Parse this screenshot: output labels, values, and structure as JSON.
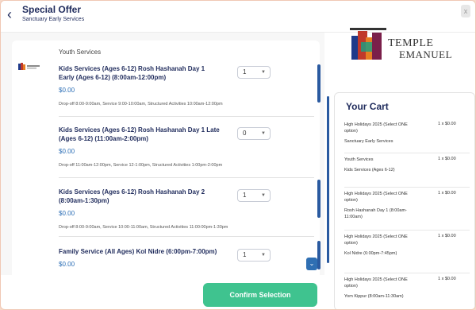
{
  "header": {
    "title": "Special Offer",
    "subtitle": "Sanctuary Early Services",
    "close_label": "x"
  },
  "list": {
    "group_label": "Youth Services",
    "items": [
      {
        "title": "Kids Services (Ages 6-12) Rosh Hashanah Day 1 Early (Ages 6-12) (8:00am-12:00pm)",
        "price": "$0.00",
        "description": "Drop-off 8:00-9:00am, Service 9:00-10:00am, Structured Activities 10:00am-12:00pm",
        "qty": "1"
      },
      {
        "title": "Kids Services (Ages 6-12) Rosh Hashanah Day 1 Late (Ages 6-12) (11:00am-2:00pm)",
        "price": "$0.00",
        "description": "Drop-off 11:00am-12:00pm, Service 12-1:00pm, Structured Activities 1:00pm-2:00pm",
        "qty": "0"
      },
      {
        "title": "Kids Services (Ages 6-12) Rosh Hashanah Day 2 (8:00am-1:30pm)",
        "price": "$0.00",
        "description": "Drop-off 8:00-9:00am, Service 10:00-11:00am, Structured Activities 11:00:00pm-1:30pm",
        "qty": "1"
      },
      {
        "title": "Family Service (All Ages) Kol Nidre (6:00pm-7:00pm)",
        "price": "$0.00",
        "description": "",
        "qty": "1"
      }
    ]
  },
  "footer": {
    "confirm_label": "Confirm Selection"
  },
  "brand": {
    "line1": "TEMPLE",
    "line2": "EMANUEL",
    "colors": [
      "#1f3a8a",
      "#c0392b",
      "#e67e22",
      "#7f8c8d",
      "#16a085"
    ]
  },
  "cart": {
    "title": "Your Cart",
    "rows": [
      {
        "name": "High Holidays 2025 (Select ONE option)",
        "sub": "Sanctuary Early Services",
        "qty": "1 x $0.00"
      },
      {
        "name": "Youth Services",
        "sub": "Kids Services (Ages 6-12)",
        "qty": "1 x $0.00"
      },
      {
        "name": "High Holidays 2025 (Select ONE option)",
        "sub": "Rosh Hashanah Day 1 (8:00am-11:00am)",
        "qty": "1 x $0.00"
      },
      {
        "name": "High Holidays 2025 (Select ONE option)",
        "sub": "Kol Nidre (6:00pm-7:45pm)",
        "qty": "1 x $0.00"
      },
      {
        "name": "High Holidays 2025 (Select ONE option)",
        "sub": "Yom Kippur (8:00am-11:30am)",
        "qty": "1 x $0.00"
      }
    ]
  },
  "icons": {
    "back": "chevron-left-icon",
    "close": "close-icon",
    "dropdown": "chevron-down-icon",
    "scroll_down": "chevron-down-icon"
  }
}
